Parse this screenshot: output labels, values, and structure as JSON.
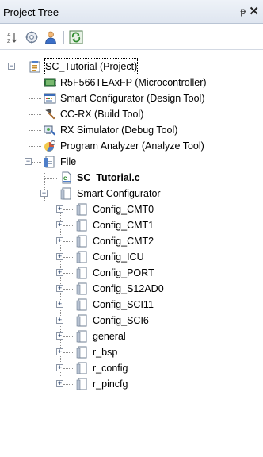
{
  "panel": {
    "title": "Project Tree",
    "pin_glyph": "ᵽ",
    "close_glyph": "✕"
  },
  "toolbar": {
    "buttons": [
      {
        "name": "sort-az-icon"
      },
      {
        "name": "properties-icon"
      },
      {
        "name": "user-icon"
      },
      {
        "name": "refresh-icon"
      }
    ]
  },
  "tree": {
    "project": "SC_Tutorial (Project)",
    "microcontroller": "R5F566TEAxFP (Microcontroller)",
    "smart_configurator_tool": "Smart Configurator (Design Tool)",
    "ccrx": "CC-RX (Build Tool)",
    "rx_simulator": "RX Simulator (Debug Tool)",
    "program_analyzer": "Program Analyzer (Analyze Tool)",
    "file": "File",
    "sc_tutorial_c": "SC_Tutorial.c",
    "smart_configurator_folder": "Smart Configurator",
    "folders": [
      "Config_CMT0",
      "Config_CMT1",
      "Config_CMT2",
      "Config_ICU",
      "Config_PORT",
      "Config_S12AD0",
      "Config_SCI11",
      "Config_SCI6",
      "general",
      "r_bsp",
      "r_config",
      "r_pincfg"
    ]
  }
}
